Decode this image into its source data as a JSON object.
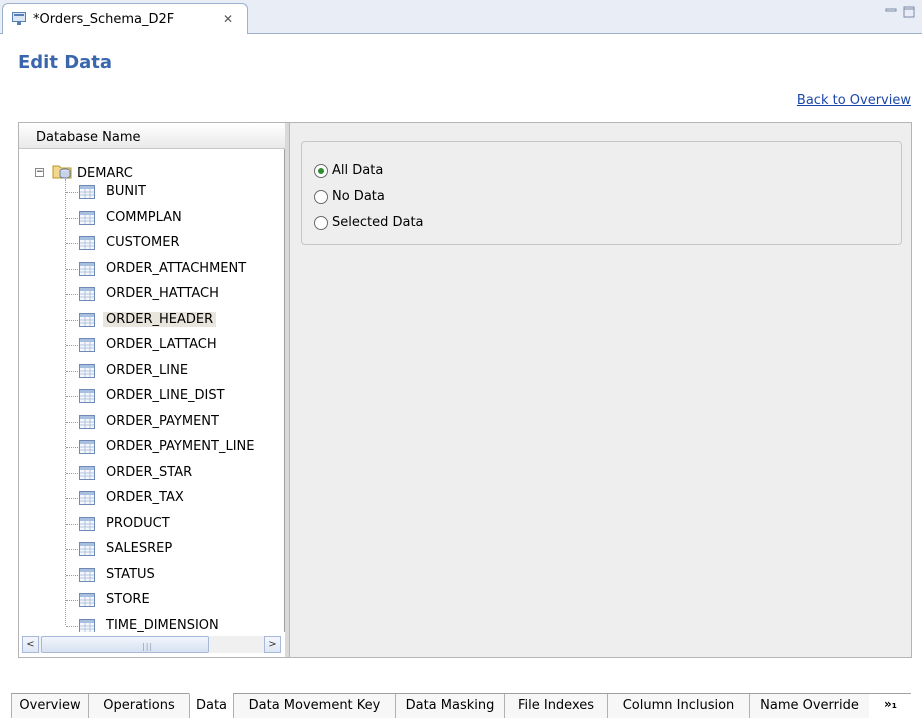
{
  "editor_tab": {
    "label": "*Orders_Schema_D2F",
    "close": "✕"
  },
  "header": {
    "title": "Edit Data",
    "back_link": "Back to Overview"
  },
  "tree": {
    "column_header": "Database Name",
    "expander": "−",
    "root": "DEMARC",
    "selected": "ORDER_HEADER",
    "items": [
      "BUNIT",
      "COMMPLAN",
      "CUSTOMER",
      "ORDER_ATTACHMENT",
      "ORDER_HATTACH",
      "ORDER_HEADER",
      "ORDER_LATTACH",
      "ORDER_LINE",
      "ORDER_LINE_DIST",
      "ORDER_PAYMENT",
      "ORDER_PAYMENT_LINE",
      "ORDER_STAR",
      "ORDER_TAX",
      "PRODUCT",
      "SALESREP",
      "STATUS",
      "STORE",
      "TIME_DIMENSION"
    ]
  },
  "scrollbar": {
    "left": "<",
    "right": ">",
    "grip": "|||"
  },
  "options": [
    {
      "label": "All Data",
      "checked": true
    },
    {
      "label": "No Data",
      "checked": false
    },
    {
      "label": "Selected Data",
      "checked": false
    }
  ],
  "page_tabs": {
    "active": "Data",
    "tabs": [
      "Overview",
      "Operations",
      "Data",
      "Data Movement Key",
      "Data Masking",
      "File Indexes",
      "Column Inclusion",
      "Name Override"
    ],
    "more": "»₁"
  }
}
